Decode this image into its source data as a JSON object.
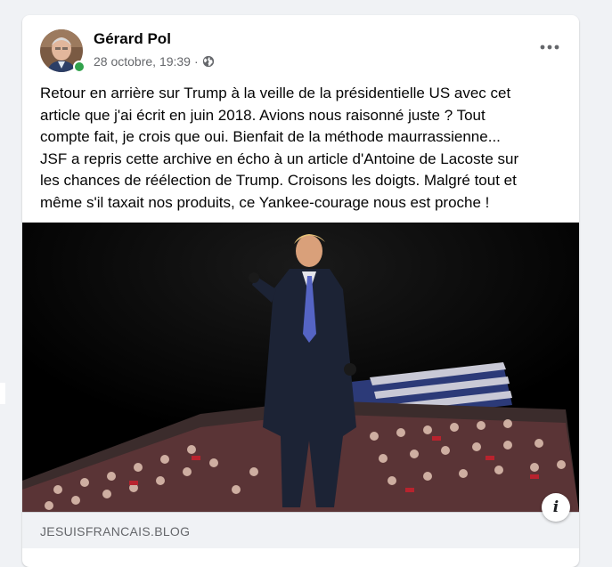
{
  "post": {
    "author": "Gérard Pol",
    "date": "28 octobre, 19:39",
    "separator": "·",
    "privacy_icon": "globe-icon",
    "more_icon": "more-horizontal-icon",
    "text_lines": [
      "Retour en arrière sur Trump à la veille de la présidentielle US avec cet",
      "article que j'ai écrit en juin 2018. Avions nous raisonné juste ? Tout",
      "compte fait, je crois que oui. Bienfait de la méthode maurrassienne...",
      "JSF a repris cette archive en écho à un article d'Antoine de Lacoste sur",
      "les chances de réélection de Trump. Croisons les doigts. Malgré tout et",
      "même s'il taxait nos produits,  ce Yankee-courage nous est proche !"
    ]
  },
  "link_preview": {
    "domain": "JESUISFRANCAIS.BLOG",
    "info_label": "i"
  },
  "colors": {
    "page_background": "#f0f2f5",
    "card_background": "#ffffff",
    "text_primary": "#050505",
    "text_secondary": "#65676b",
    "online": "#31a24c"
  }
}
